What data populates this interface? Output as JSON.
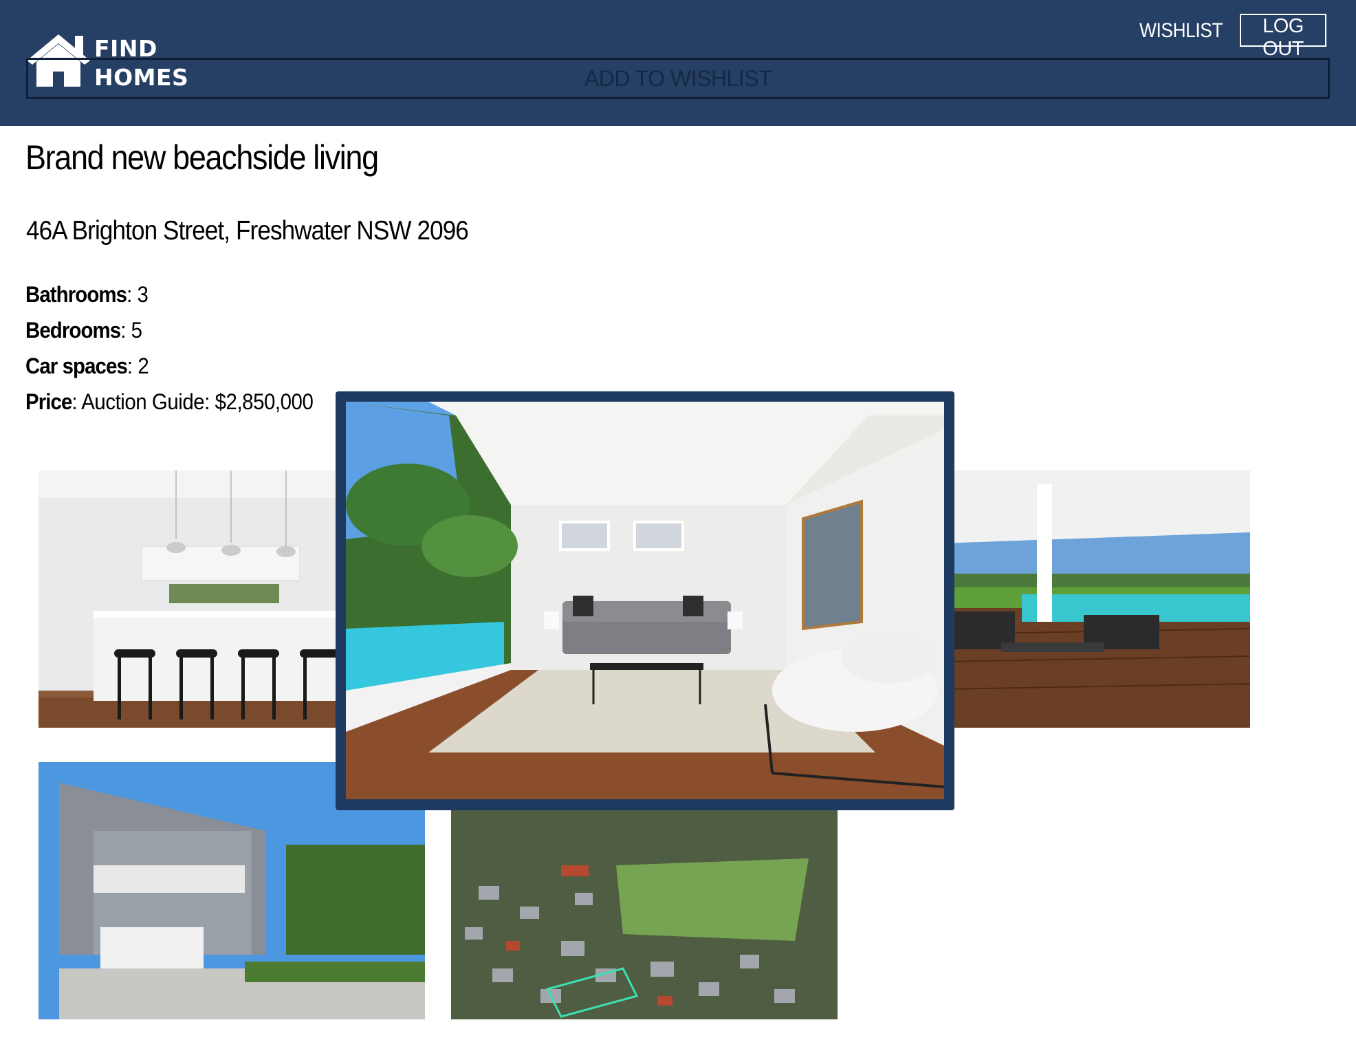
{
  "header": {
    "logo_line1": "FIND",
    "logo_line2": "HOMES",
    "nav": {
      "wishlist": "WISHLIST",
      "logout": "LOG OUT"
    },
    "add_to_wishlist": "ADD TO WISHLIST",
    "background_color": "#264065"
  },
  "listing": {
    "title": "Brand new beachside living",
    "address": "46A Brighton Street, Freshwater NSW 2096",
    "details": [
      {
        "label": "Bathrooms",
        "value": ": 3"
      },
      {
        "label": "Bedrooms",
        "value": ": 5"
      },
      {
        "label": "Car spaces",
        "value": ": 2"
      },
      {
        "label": "Price",
        "value": ": Auction Guide: $2,850,000"
      }
    ]
  },
  "gallery": {
    "photos": [
      "kitchen",
      "outdoor-patio",
      "house-exterior",
      "aerial-view"
    ],
    "lightbox_photo": "living-room",
    "lightbox_border_color": "#1f3a60"
  }
}
